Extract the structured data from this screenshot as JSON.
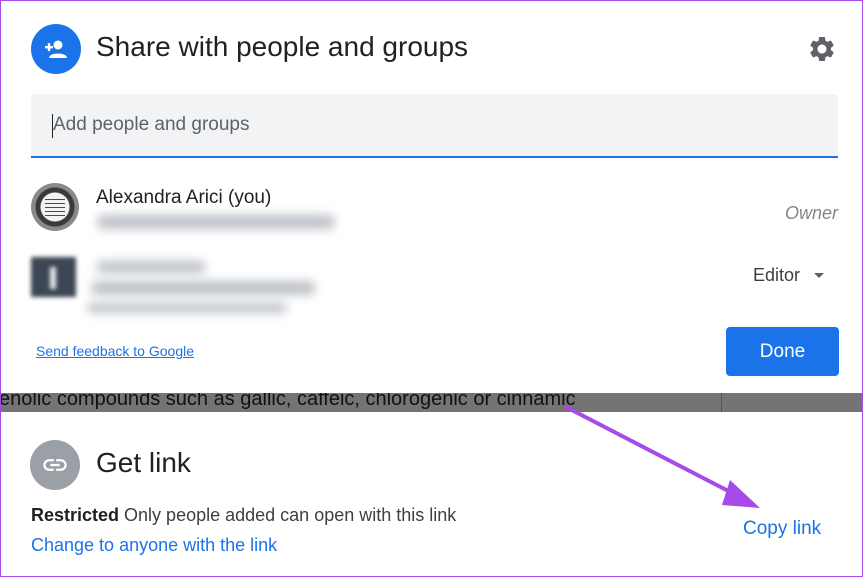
{
  "share": {
    "title": "Share with people and groups",
    "header_icon": "person-add-icon",
    "settings_icon": "gear-icon",
    "input_placeholder": "Add people and groups",
    "people": [
      {
        "name": "Alexandra Arici (you)",
        "role": "Owner"
      },
      {
        "role": "Editor"
      }
    ],
    "feedback_label": "Send feedback to Google",
    "done_label": "Done"
  },
  "document": {
    "visible_text": "enolic compounds such as gallic, caffeic, chlorogenic or cinnamic"
  },
  "get_link": {
    "title": "Get link",
    "icon": "link-icon",
    "access_level": "Restricted",
    "access_description": "Only people added can open with this link",
    "change_label": "Change to anyone with the link",
    "copy_label": "Copy link"
  },
  "colors": {
    "accent": "#1a73e8",
    "annotation_arrow": "#a64be8",
    "link_avatar": "#9aa0a6"
  }
}
